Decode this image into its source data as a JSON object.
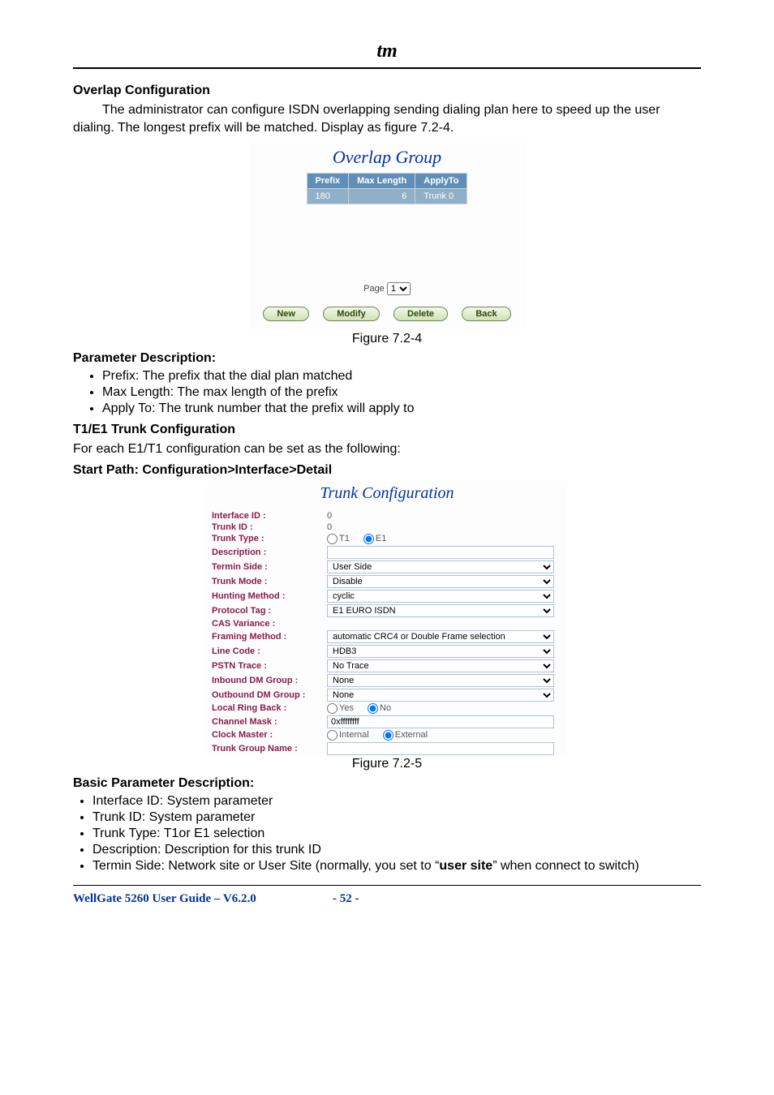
{
  "logo": "tm",
  "sections": {
    "overlap_title": "Overlap Configuration",
    "overlap_body": "The administrator can configure ISDN overlapping sending dialing plan here to speed up the user dialing. The longest prefix will be matched. Display as figure 7.2-4.",
    "param_desc_title": "Parameter Description:",
    "param_items": {
      "prefix": "Prefix: The prefix that the dial plan matched",
      "maxlen": "Max Length: The max length of the prefix",
      "applyto": "Apply To: The trunk number that the prefix will apply to"
    },
    "t1e1_title": "T1/E1 Trunk Configuration",
    "t1e1_body": "For each E1/T1 configuration can be set as the following:",
    "startpath": "Start Path: Configuration>Interface>Detail",
    "basic_param_title": "Basic Parameter Description:",
    "basic_items": {
      "ifid": "Interface ID: System parameter",
      "tid": "Trunk ID: System parameter",
      "ttype": "Trunk Type: T1or E1 selection",
      "desc": "Description: Description for this trunk ID",
      "termin_a": "Termin Side: Network site or User Site (normally, you set to “",
      "termin_b": "user site",
      "termin_c": "” when connect to switch)"
    }
  },
  "figcaps": {
    "f724": "Figure 7.2-4",
    "f725": "Figure 7.2-5"
  },
  "overlap_group": {
    "title": "Overlap Group",
    "headers": {
      "prefix": "Prefix",
      "maxlen": "Max Length",
      "applyto": "ApplyTo"
    },
    "row": {
      "prefix": "180",
      "maxlen": "6",
      "applyto": "Trunk 0"
    },
    "page_label": "Page",
    "page_value": "1",
    "btn_new": "New",
    "btn_modify": "Modify",
    "btn_delete": "Delete",
    "btn_back": "Back"
  },
  "trunk_config": {
    "title": "Trunk Configuration",
    "labels": {
      "ifid": "Interface ID :",
      "tid": "Trunk ID :",
      "ttype": "Trunk Type :",
      "desc": "Description :",
      "termin": "Termin Side :",
      "mode": "Trunk Mode :",
      "hunt": "Hunting Method :",
      "ptag": "Protocol Tag :",
      "cas": "CAS Variance :",
      "framing": "Framing Method :",
      "lcode": "Line Code :",
      "pstn": "PSTN Trace :",
      "indm": "Inbound DM Group :",
      "outdm": "Outbound DM Group :",
      "ringback": "Local Ring Back :",
      "cmask": "Channel Mask :",
      "clkm": "Clock Master :",
      "tgn": "Trunk Group Name :"
    },
    "values": {
      "ifid": "0",
      "tid": "0",
      "ttype_t1": "T1",
      "ttype_e1": "E1",
      "termin": "User Side",
      "mode": "Disable",
      "hunt": "cyclic",
      "ptag": "E1 EURO ISDN",
      "framing": "automatic CRC4 or Double Frame selection",
      "lcode": "HDB3",
      "pstn": "No Trace",
      "indm": "None",
      "outdm": "None",
      "ringback_yes": "Yes",
      "ringback_no": "No",
      "cmask": "0xffffffff",
      "clkm_int": "Internal",
      "clkm_ext": "External"
    }
  },
  "footer": {
    "left": "WellGate 5260 User Guide – V6.2.0",
    "center": "- 52 -"
  }
}
